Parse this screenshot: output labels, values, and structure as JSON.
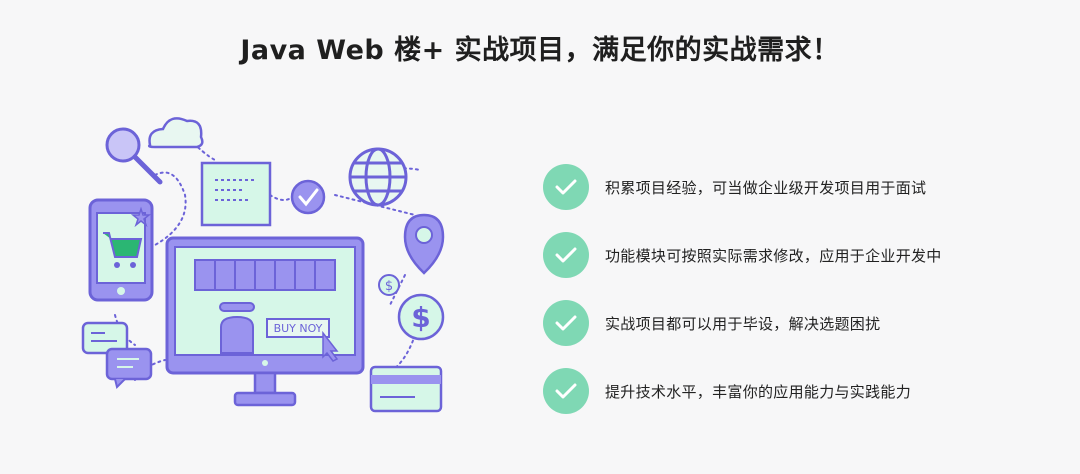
{
  "header": {
    "title": "Java Web 楼+ 实战项目，满足你的实战需求！"
  },
  "illustration": {
    "screen_sign_text": "BUY NOY",
    "colors": {
      "outline": "#6c63d8",
      "fill_mint": "#d6f7e8",
      "fill_purple": "#9a93ef",
      "accent_green": "#2bb673"
    }
  },
  "features": [
    {
      "label": "积累项目经验，可当做企业级开发项目用于面试",
      "icon": "check-icon"
    },
    {
      "label": "功能模块可按照实际需求修改，应用于企业开发中",
      "icon": "check-icon"
    },
    {
      "label": "实战项目都可以用于毕设，解决选题困扰",
      "icon": "check-icon"
    },
    {
      "label": "提升技术水平，丰富你的应用能力与实践能力",
      "icon": "check-icon"
    }
  ],
  "colors": {
    "check_bg": "#7fd8b4",
    "text": "#222222",
    "background": "#f7f7f8"
  }
}
